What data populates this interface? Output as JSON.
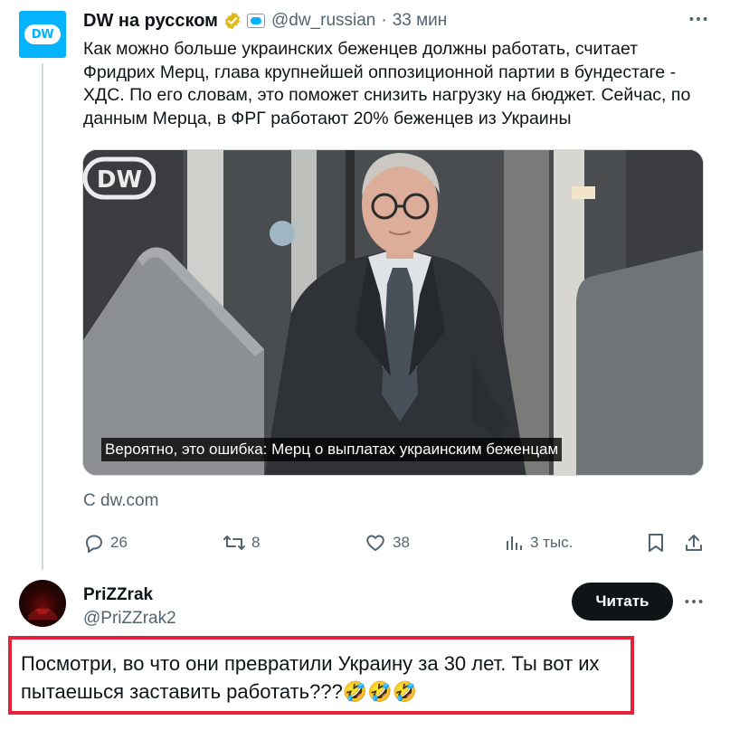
{
  "tweet": {
    "author": {
      "display_name": "DW на русском",
      "handle": "@dw_russian",
      "avatar_text": "DW"
    },
    "separator": "·",
    "time": "33 мин",
    "text": "Как можно больше украинских беженцев должны работать, считает Фридрих Мерц, глава крупнейшей оппозиционной партии в бундестаге - ХДС. По его словам, это поможет снизить нагрузку на бюджет. Сейчас, по данным Мерца, в ФРГ работают 20% беженцев из Украины",
    "media": {
      "caption": "Вероятно, это ошибка: Мерц о выплатах украинским беженцам",
      "watermark": "DW"
    },
    "source": "С dw.com",
    "actions": {
      "replies": "26",
      "retweets": "8",
      "likes": "38",
      "views": "3 тыс."
    }
  },
  "reply": {
    "author": {
      "display_name": "PriZZrak",
      "handle": "@PriZZrak2"
    },
    "follow_label": "Читать",
    "text": "Посмотри, во что они превратили Украину за 30 лет. Ты вот их пытаешься заставить работать???🤣🤣🤣"
  },
  "colors": {
    "accent_dw": "#05b2fc",
    "verified_gold": "#e2b719",
    "highlight_border": "#e5223c",
    "secondary_text": "#536471"
  }
}
